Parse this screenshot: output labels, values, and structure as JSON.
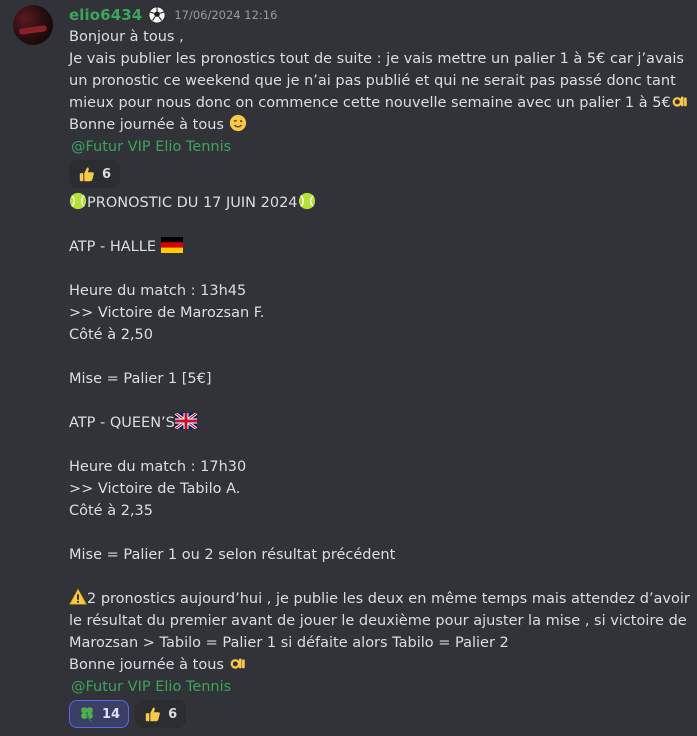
{
  "message1": {
    "username": "elio6434",
    "timestamp": "17/06/2024 12:16",
    "lines": [
      "Bonjour à tous ,",
      "Je vais publier les pronostics tout de suite : je vais mettre un palier 1 à 5€ car j’avais",
      "un pronostic ce weekend que je n’ai pas publié et qui ne serait pas passé donc tant",
      "mieux pour nous donc on commence cette nouvelle semaine avec un palier 1 à 5€",
      "Bonne journée à tous "
    ],
    "mention": "@Futur VIP Elio Tennis",
    "reactions": [
      {
        "emoji": "thumbs-up",
        "count": "6"
      }
    ]
  },
  "message2": {
    "lines": {
      "title": "PRONOSTIC DU 17 JUIN 2024",
      "match1_tournament": "ATP - HALLE ",
      "match1_time": "Heure du match : 13h45",
      "match1_pick": ">> Victoire de Marozsan F.",
      "match1_odds": "Côté à 2,50",
      "match1_stake": "Mise = Palier 1 [5€]",
      "match2_tournament": "ATP - QUEEN’S",
      "match2_time": "Heure du match : 17h30",
      "match2_pick": ">> Victoire de Tabilo A.",
      "match2_odds": "Côté à 2,35",
      "match2_stake": "Mise = Palier 1 ou 2 selon résultat précédent",
      "note1": "2 pronostics aujourd’hui , je publie les deux en même temps mais attendez d’avoir",
      "note2": "le résultat du premier avant de jouer le deuxième pour ajuster la mise , si victoire de",
      "note3": "Marozsan > Tabilo = Palier 1 si défaite alors Tabilo = Palier 2",
      "note4": "Bonne journée à tous "
    },
    "mention": "@Futur VIP Elio Tennis",
    "reactions": [
      {
        "emoji": "four-leaf-clover",
        "count": "14",
        "active": true
      },
      {
        "emoji": "thumbs-up",
        "count": "6"
      }
    ]
  },
  "colors": {
    "background": "#313338",
    "username": "#3ba55d",
    "text": "#dbdee1",
    "timestamp": "#949ba4",
    "reaction_active_border": "#5865f2"
  }
}
